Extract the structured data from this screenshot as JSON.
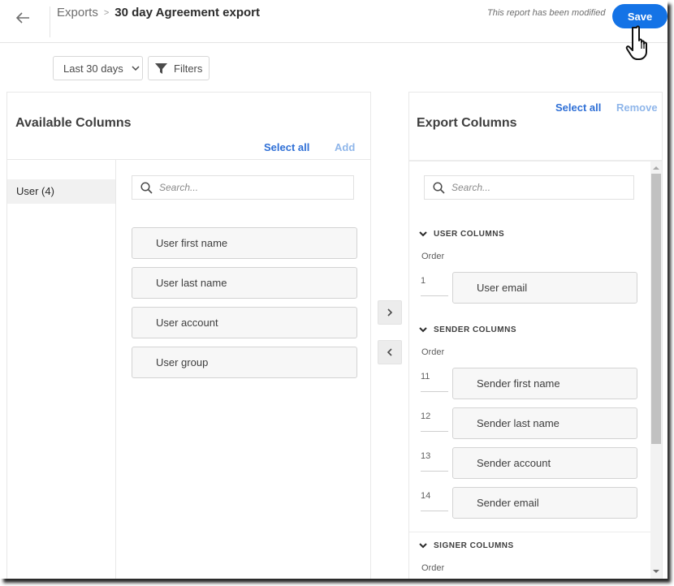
{
  "header": {
    "back_icon": "arrow-left-icon",
    "breadcrumb_parent": "Exports",
    "breadcrumb_separator": ">",
    "title": "30 day Agreement export",
    "modified_note": "This report has been modified",
    "save_label": "Save"
  },
  "colors": {
    "accent": "#1473e6",
    "link": "#2e6fd6",
    "link_disabled": "#8fb6ea"
  },
  "toolbar": {
    "date_range": "Last 30 days",
    "filters_label": "Filters"
  },
  "available": {
    "title": "Available Columns",
    "select_all": "Select all",
    "add": "Add",
    "categories": [
      {
        "label": "User (4)",
        "selected": true
      }
    ],
    "search_placeholder": "Search...",
    "items": [
      "User first name",
      "User last name",
      "User account",
      "User group"
    ]
  },
  "move": {
    "add_icon": "chevron-right-icon",
    "remove_icon": "chevron-left-icon"
  },
  "export": {
    "title": "Export Columns",
    "select_all": "Select all",
    "remove": "Remove",
    "search_placeholder": "Search...",
    "order_label": "Order",
    "sections": [
      {
        "title": "USER COLUMNS",
        "items": [
          {
            "order": "1",
            "label": "User email"
          }
        ]
      },
      {
        "title": "SENDER COLUMNS",
        "items": [
          {
            "order": "11",
            "label": "Sender first name"
          },
          {
            "order": "12",
            "label": "Sender last name"
          },
          {
            "order": "13",
            "label": "Sender account"
          },
          {
            "order": "14",
            "label": "Sender email"
          }
        ]
      },
      {
        "title": "SIGNER COLUMNS",
        "items": []
      }
    ]
  }
}
